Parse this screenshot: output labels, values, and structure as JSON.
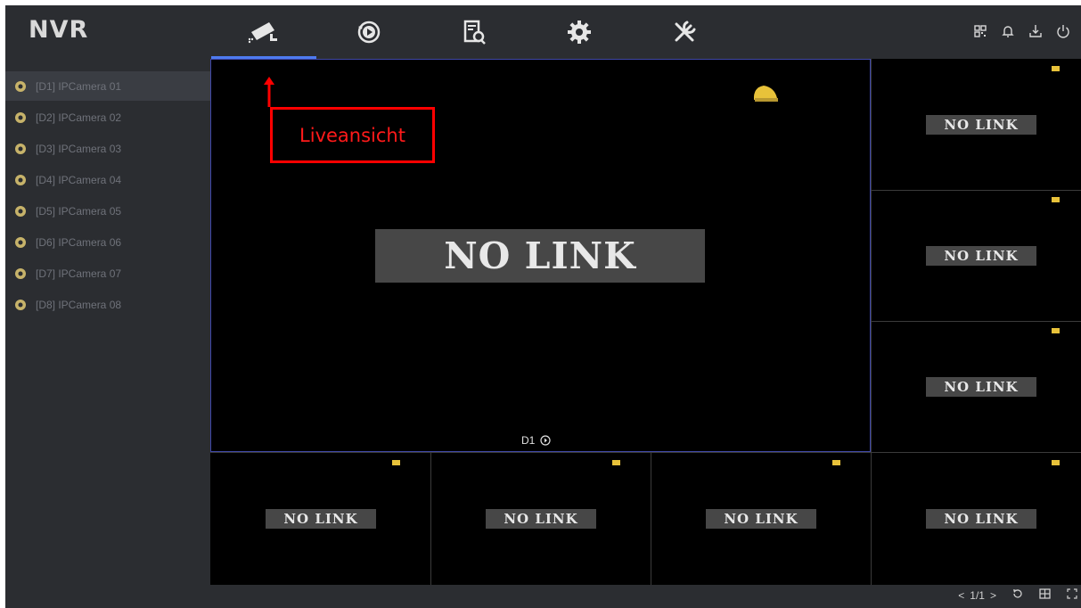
{
  "app": {
    "logo": "NVR"
  },
  "nav": [
    {
      "id": "live",
      "icon": "camera-icon",
      "active": true
    },
    {
      "id": "playback",
      "icon": "playback-icon",
      "active": false
    },
    {
      "id": "search",
      "icon": "search-file-icon",
      "active": false
    },
    {
      "id": "settings",
      "icon": "gear-icon",
      "active": false
    },
    {
      "id": "tools",
      "icon": "wrench-icon",
      "active": false
    }
  ],
  "header_icons": [
    "qr-code-icon",
    "bell-icon",
    "download-icon",
    "power-icon"
  ],
  "cameras": [
    "[D1] IPCamera 01",
    "[D2] IPCamera 02",
    "[D3] IPCamera 03",
    "[D4] IPCamera 04",
    "[D5] IPCamera 05",
    "[D6] IPCamera 06",
    "[D7] IPCamera 07",
    "[D8] IPCamera 08"
  ],
  "main_tile": {
    "label": "D1",
    "status": "NO LINK"
  },
  "tiles_status": "NO LINK",
  "annotation": {
    "text": "Liveansicht"
  },
  "statusbar": {
    "page": "1/1",
    "prev": "<",
    "next": ">"
  },
  "colors": {
    "accent": "#4e7bf0",
    "annotation": "#ff0000",
    "motion": "#e8c23a"
  }
}
